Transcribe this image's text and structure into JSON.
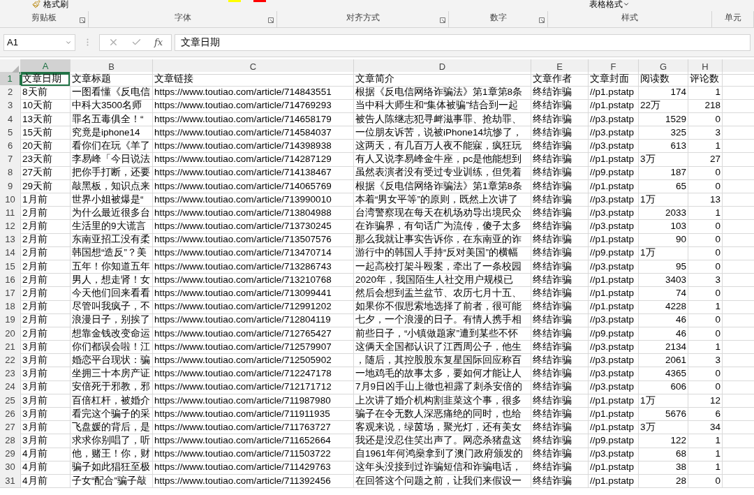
{
  "ribbon": {
    "top_items": [
      {
        "kind": "brush",
        "label": "格式刷"
      },
      {
        "kind": "dropdown",
        "label": "表格格式"
      }
    ],
    "groups": [
      {
        "label": "剪贴板",
        "launcher": true
      },
      {
        "label": "字体",
        "launcher": true
      },
      {
        "label": "对齐方式",
        "launcher": true
      },
      {
        "label": "数字",
        "launcher": true
      },
      {
        "label": "样式",
        "launcher": false
      },
      {
        "label": "单元",
        "launcher": false
      }
    ]
  },
  "formula_bar": {
    "name_box": "A1",
    "function_label": "fx",
    "value": "文章日期"
  },
  "columns": [
    {
      "letter": "A",
      "selected": true
    },
    {
      "letter": "B",
      "selected": false
    },
    {
      "letter": "C",
      "selected": false
    },
    {
      "letter": "D",
      "selected": false
    },
    {
      "letter": "E",
      "selected": false
    },
    {
      "letter": "F",
      "selected": false
    },
    {
      "letter": "G",
      "selected": false
    },
    {
      "letter": "H",
      "selected": false
    }
  ],
  "header_row": {
    "number": "1",
    "selected": true,
    "cells": [
      "文章日期",
      "文章标题",
      "文章链接",
      "文章简介",
      "文章作者",
      "文章封面",
      "阅读数",
      "评论数"
    ]
  },
  "rows": [
    {
      "number": "2",
      "date": "8天前",
      "title": "一图看懂《反电信",
      "url": "https://www.toutiao.com/article/714843551",
      "summary": "根据《反电信网络诈骗法》第1章第8条",
      "author": "终结诈骗",
      "cover": "//p1.pstatp",
      "reads": {
        "value": "174",
        "kind": "number"
      },
      "comments": "1"
    },
    {
      "number": "3",
      "date": "10天前",
      "title": "中科大3500名师",
      "url": "https://www.toutiao.com/article/714769293",
      "summary": "当中科大师生和“集体被骗”结合到一起",
      "author": "终结诈骗",
      "cover": "//p1.pstatp",
      "reads": {
        "value": "22万",
        "kind": "text"
      },
      "comments": "218"
    },
    {
      "number": "4",
      "date": "13天前",
      "title": "罪名五毒俱全！“",
      "url": "https://www.toutiao.com/article/714658179",
      "summary": "被告人陈继志犯寻衅滋事罪、抢劫罪、",
      "author": "终结诈骗",
      "cover": "//p3.pstatp",
      "reads": {
        "value": "1529",
        "kind": "number"
      },
      "comments": "0"
    },
    {
      "number": "5",
      "date": "15天前",
      "title": "究竟是iphone14",
      "url": "https://www.toutiao.com/article/714584037",
      "summary": "一位朋友诉苦，说被iPhone14坑惨了，",
      "author": "终结诈骗",
      "cover": "//p3.pstatp",
      "reads": {
        "value": "325",
        "kind": "number"
      },
      "comments": "3"
    },
    {
      "number": "6",
      "date": "20天前",
      "title": "看你们在玩《羊了",
      "url": "https://www.toutiao.com/article/714398938",
      "summary": "这两天，有几百万人夜不能寐，疯狂玩",
      "author": "终结诈骗",
      "cover": "//p3.pstatp",
      "reads": {
        "value": "613",
        "kind": "number"
      },
      "comments": "1"
    },
    {
      "number": "7",
      "date": "23天前",
      "title": "李易峰「今日说法",
      "url": "https://www.toutiao.com/article/714287129",
      "summary": "有人又说李易峰金牛座，pc是他能想到",
      "author": "终结诈骗",
      "cover": "//p1.pstatp",
      "reads": {
        "value": "3万",
        "kind": "text"
      },
      "comments": "27"
    },
    {
      "number": "8",
      "date": "27天前",
      "title": "把你手打断，还要",
      "url": "https://www.toutiao.com/article/714138467",
      "summary": "虽然表演者没有受过专业训练，但凭着",
      "author": "终结诈骗",
      "cover": "//p9.pstatp",
      "reads": {
        "value": "187",
        "kind": "number"
      },
      "comments": "0"
    },
    {
      "number": "9",
      "date": "29天前",
      "title": "敲黑板，知识点来",
      "url": "https://www.toutiao.com/article/714065769",
      "summary": "根据《反电信网络诈骗法》第1章第8条",
      "author": "终结诈骗",
      "cover": "//p1.pstatp",
      "reads": {
        "value": "65",
        "kind": "number"
      },
      "comments": "0"
    },
    {
      "number": "10",
      "date": "1月前",
      "title": "世界小姐被爆是“",
      "url": "https://www.toutiao.com/article/713990010",
      "summary": "本着“男女平等”的原则，既然上次讲了",
      "author": "终结诈骗",
      "cover": "//p3.pstatp",
      "reads": {
        "value": "1万",
        "kind": "text"
      },
      "comments": "13"
    },
    {
      "number": "11",
      "date": "2月前",
      "title": "为什么最近很多台",
      "url": "https://www.toutiao.com/article/713804988",
      "summary": "台湾警察现在每天在机场劝导出境民众",
      "author": "终结诈骗",
      "cover": "//p3.pstatp",
      "reads": {
        "value": "2033",
        "kind": "number"
      },
      "comments": "1"
    },
    {
      "number": "12",
      "date": "2月前",
      "title": "生活里的9大谎言",
      "url": "https://www.toutiao.com/article/713730245",
      "summary": "在诈骗界，有句话广为流传，傻子太多",
      "author": "终结诈骗",
      "cover": "//p3.pstatp",
      "reads": {
        "value": "103",
        "kind": "number"
      },
      "comments": "0"
    },
    {
      "number": "13",
      "date": "2月前",
      "title": "东南亚招工没有柔",
      "url": "https://www.toutiao.com/article/713507576",
      "summary": "那么我就让事实告诉你，在东南亚的诈",
      "author": "终结诈骗",
      "cover": "//p1.pstatp",
      "reads": {
        "value": "90",
        "kind": "number"
      },
      "comments": "0"
    },
    {
      "number": "14",
      "date": "2月前",
      "title": "韩国想“造反”？美",
      "url": "https://www.toutiao.com/article/713470714",
      "summary": "游行中的韩国人手持“反对美国”的横幅",
      "author": "终结诈骗",
      "cover": "//p9.pstatp",
      "reads": {
        "value": "1万",
        "kind": "text"
      },
      "comments": "0"
    },
    {
      "number": "15",
      "date": "2月前",
      "title": "五年！你知道五年",
      "url": "https://www.toutiao.com/article/713286743",
      "summary": "一起高校打架斗殴案，牵出了一条校园",
      "author": "终结诈骗",
      "cover": "//p3.pstatp",
      "reads": {
        "value": "95",
        "kind": "number"
      },
      "comments": "0"
    },
    {
      "number": "16",
      "date": "2月前",
      "title": "男人，想走肾！女",
      "url": "https://www.toutiao.com/article/713210768",
      "summary": "2020年，我国陌生人社交用户规模已",
      "author": "终结诈骗",
      "cover": "//p1.pstatp",
      "reads": {
        "value": "3403",
        "kind": "number"
      },
      "comments": "3"
    },
    {
      "number": "17",
      "date": "2月前",
      "title": "今天他们回来看看",
      "url": "https://www.toutiao.com/article/713099441",
      "summary": "然后会想到盂兰盆节、农历七月十五、",
      "author": "终结诈骗",
      "cover": "//p1.pstatp",
      "reads": {
        "value": "74",
        "kind": "number"
      },
      "comments": "0"
    },
    {
      "number": "18",
      "date": "2月前",
      "title": "尽管叫我疯子，不",
      "url": "https://www.toutiao.com/article/712991202",
      "summary": "如果你不假思索地选择了前者，很可能",
      "author": "终结诈骗",
      "cover": "//p1.pstatp",
      "reads": {
        "value": "4228",
        "kind": "number"
      },
      "comments": "1"
    },
    {
      "number": "19",
      "date": "2月前",
      "title": "浪漫日子，别挨了",
      "url": "https://www.toutiao.com/article/712804119",
      "summary": "七夕，一个浪漫的日子。有情人携手相",
      "author": "终结诈骗",
      "cover": "//p3.pstatp",
      "reads": {
        "value": "46",
        "kind": "number"
      },
      "comments": "0"
    },
    {
      "number": "20",
      "date": "2月前",
      "title": "想靠金钱改变命运",
      "url": "https://www.toutiao.com/article/712765427",
      "summary": "前些日子，“小镇做题家”遭到某些不怀",
      "author": "终结诈骗",
      "cover": "//p9.pstatp",
      "reads": {
        "value": "46",
        "kind": "number"
      },
      "comments": "0"
    },
    {
      "number": "21",
      "date": "3月前",
      "title": "你们都误会啦！江",
      "url": "https://www.toutiao.com/article/712579907",
      "summary": "这俩天全国都认识了江西周公子，他生",
      "author": "终结诈骗",
      "cover": "//p3.pstatp",
      "reads": {
        "value": "2134",
        "kind": "number"
      },
      "comments": "1"
    },
    {
      "number": "22",
      "date": "3月前",
      "title": "婚恋平台现状：骗",
      "url": "https://www.toutiao.com/article/712505902",
      "summary": "，随后，其控股股东复星国际回应称百",
      "author": "终结诈骗",
      "cover": "//p3.pstatp",
      "reads": {
        "value": "2061",
        "kind": "number"
      },
      "comments": "3"
    },
    {
      "number": "23",
      "date": "3月前",
      "title": "坐拥三十本房产证",
      "url": "https://www.toutiao.com/article/712247178",
      "summary": "一地鸡毛的故事太多，要如何才能让人",
      "author": "终结诈骗",
      "cover": "//p3.pstatp",
      "reads": {
        "value": "4365",
        "kind": "number"
      },
      "comments": "0"
    },
    {
      "number": "24",
      "date": "3月前",
      "title": "安倍死于邪教，邪",
      "url": "https://www.toutiao.com/article/712171712",
      "summary": "7月9日凶手山上徹也袒露了刺杀安倍的",
      "author": "终结诈骗",
      "cover": "//p3.pstatp",
      "reads": {
        "value": "606",
        "kind": "number"
      },
      "comments": "0"
    },
    {
      "number": "25",
      "date": "3月前",
      "title": "百倍杠杆，被婚介",
      "url": "https://www.toutiao.com/article/711987980",
      "summary": "上次讲了婚介机构割韭菜这个事，很多",
      "author": "终结诈骗",
      "cover": "//p1.pstatp",
      "reads": {
        "value": "1万",
        "kind": "text"
      },
      "comments": "12"
    },
    {
      "number": "26",
      "date": "3月前",
      "title": "看完这个骗子的采",
      "url": "https://www.toutiao.com/article/711911935",
      "summary": "骗子在令无数人深恶痛绝的同时，也给",
      "author": "终结诈骗",
      "cover": "//p1.pstatp",
      "reads": {
        "value": "5676",
        "kind": "number"
      },
      "comments": "6"
    },
    {
      "number": "27",
      "date": "3月前",
      "title": "飞盘媛的背后，是",
      "url": "https://www.toutiao.com/article/711763727",
      "summary": "客观来说，绿茵场，聚光灯，还有美女",
      "author": "终结诈骗",
      "cover": "//p1.pstatp",
      "reads": {
        "value": "3万",
        "kind": "text"
      },
      "comments": "34"
    },
    {
      "number": "28",
      "date": "3月前",
      "title": "求求你别唱了，听",
      "url": "https://www.toutiao.com/article/711652664",
      "summary": "我还是没忍住笑出声了。网恋杀猪盘这",
      "author": "终结诈骗",
      "cover": "//p9.pstatp",
      "reads": {
        "value": "122",
        "kind": "number"
      },
      "comments": "1"
    },
    {
      "number": "29",
      "date": "4月前",
      "title": "他，赌王！你，财",
      "url": "https://www.toutiao.com/article/711503722",
      "summary": "自1961年何鸿燊拿到了澳门政府颁发的",
      "author": "终结诈骗",
      "cover": "//p3.pstatp",
      "reads": {
        "value": "68",
        "kind": "number"
      },
      "comments": "1"
    },
    {
      "number": "30",
      "date": "4月前",
      "title": "骗子如此猖狂至极",
      "url": "https://www.toutiao.com/article/711429763",
      "summary": "这年头没接到过诈骗短信和诈骗电话，",
      "author": "终结诈骗",
      "cover": "//p1.pstatp",
      "reads": {
        "value": "38",
        "kind": "number"
      },
      "comments": "1"
    },
    {
      "number": "31",
      "date": "4月前",
      "title": "子女“配合”骗子敲",
      "url": "https://www.toutiao.com/article/711392456",
      "summary": "在回答这个问题之前，让我们来假设一",
      "author": "终结诈骗",
      "cover": "//p1.pstatp",
      "reads": {
        "value": "28",
        "kind": "number"
      },
      "comments": "0"
    }
  ]
}
